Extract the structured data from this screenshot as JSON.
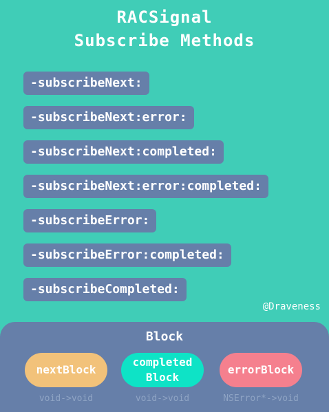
{
  "title": {
    "line1": "RACSignal",
    "line2": "Subscribe Methods"
  },
  "methods": [
    "-subscribeNext:",
    "-subscribeNext:error:",
    "-subscribeNext:completed:",
    "-subscribeNext:error:completed:",
    "-subscribeError:",
    "-subscribeError:completed:",
    "-subscribeCompleted:"
  ],
  "credit": "@Draveness",
  "panel": {
    "title": "Block",
    "blocks": [
      {
        "label": "nextBlock",
        "signature": "void->void",
        "color": "#f2c27a"
      },
      {
        "label_line1": "completed",
        "label_line2": "Block",
        "signature": "void->void",
        "color": "#0ee3c6"
      },
      {
        "label": "errorBlock",
        "signature": "NSError*->void",
        "color": "#f5808e"
      }
    ]
  },
  "colors": {
    "background": "#40cdb7",
    "method_box": "#667fa9",
    "text": "#ffffff",
    "signature_text": "#8fa4c4"
  }
}
